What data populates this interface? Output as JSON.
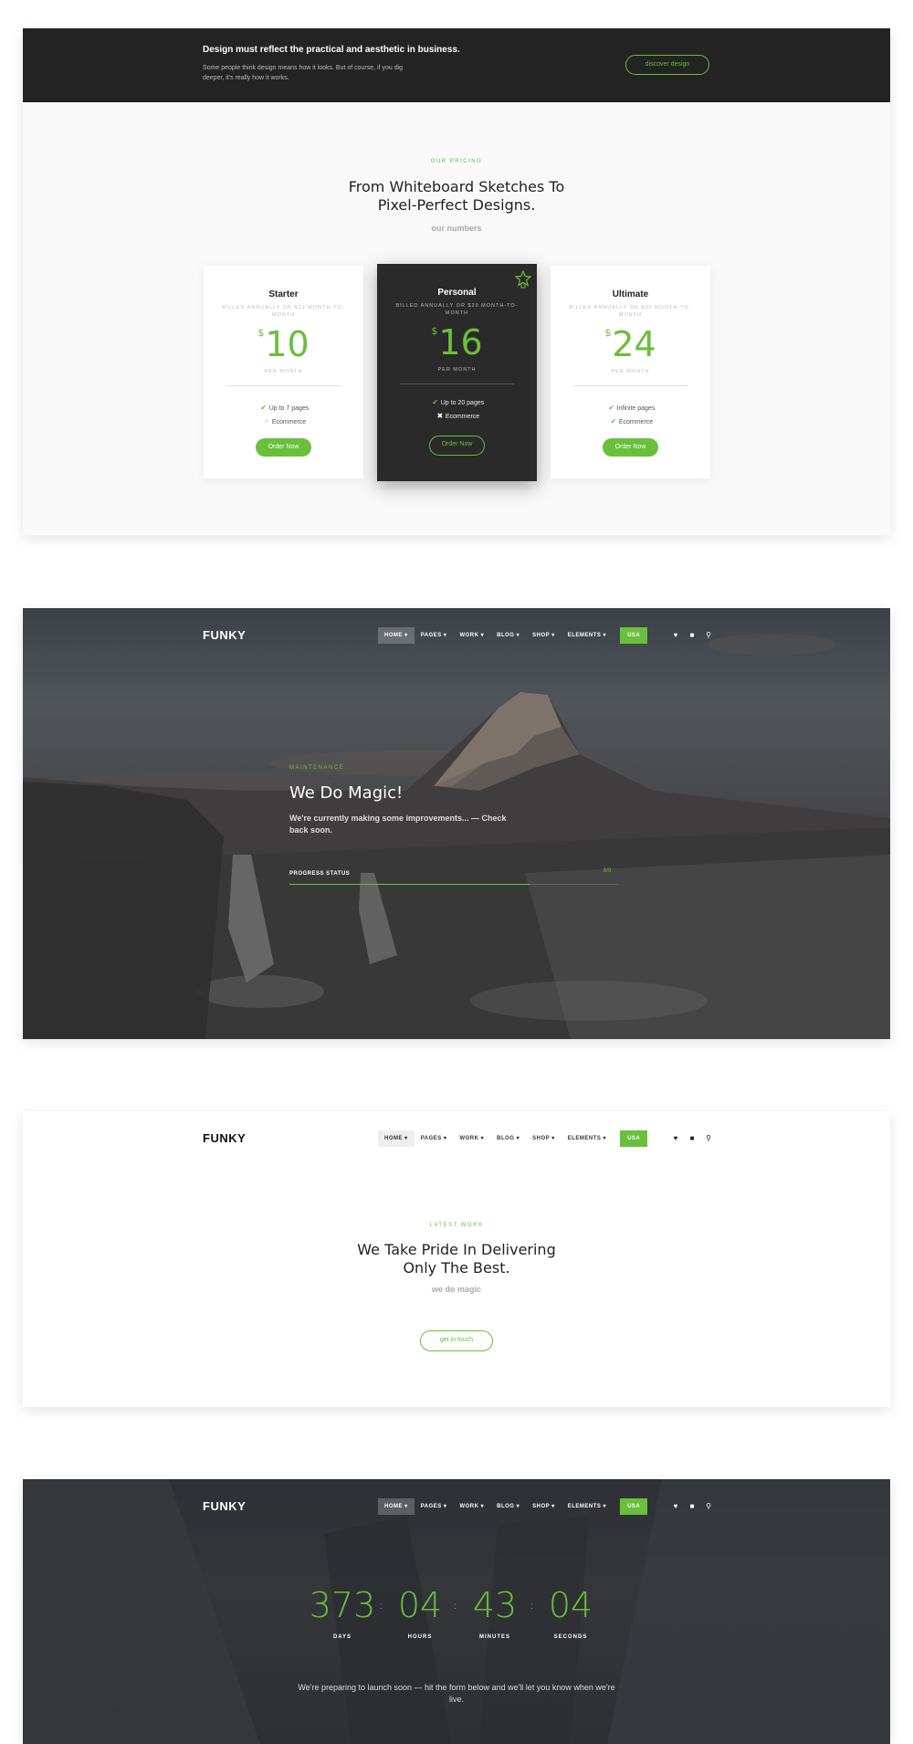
{
  "colors": {
    "accent": "#6abf3b",
    "dark": "#232323"
  },
  "panel1": {
    "bar": {
      "headline": "Design must reflect the practical and aesthetic in business.",
      "text": "Some people think design means how it looks. But of course, if you dig deeper, it's really how it works.",
      "button": "discover design"
    },
    "eyebrow": "OUR PRICING",
    "title_line1": "From Whiteboard Sketches To",
    "title_line2": "Pixel-Perfect Designs.",
    "subtitle": "our numbers",
    "plans": [
      {
        "name": "Starter",
        "billed": "BILLED ANNUALLY OR $12 MONTH-TO-MONTH",
        "currency": "$",
        "price": "10",
        "period": "PER MONTH",
        "features": [
          {
            "label": "Up to 7 pages",
            "mark": "check-icon"
          },
          {
            "label": "Ecommerce",
            "mark": "disabled-icon"
          }
        ],
        "button": "Order Now"
      },
      {
        "name": "Personal",
        "billed": "BILLED ANNUALLY OR $20 MONTH-TO-MONTH",
        "currency": "$",
        "price": "16",
        "period": "PER MONTH",
        "features": [
          {
            "label": "Up to 20 pages",
            "mark": "check-icon"
          },
          {
            "label": "Ecommerce",
            "mark": "close-icon"
          }
        ],
        "button": "Order Now",
        "featured": true
      },
      {
        "name": "Ultimate",
        "billed": "BILLED ANNUALLY OR $30 MONTH-TO-MONTH",
        "currency": "$",
        "price": "24",
        "period": "PER MONTH",
        "features": [
          {
            "label": "Infinite pages",
            "mark": "check-icon"
          },
          {
            "label": "Ecommerce",
            "mark": "check-icon"
          }
        ],
        "button": "Order Now"
      }
    ]
  },
  "nav": {
    "logo": "FUNKY",
    "items": [
      "HOME ▾",
      "PAGES ▾",
      "WORK ▾",
      "BLOG ▾",
      "SHOP ▾",
      "ELEMENTS ▾"
    ],
    "region": "USA"
  },
  "panel2": {
    "eyebrow": "MAINTENANCE",
    "title": "We Do Magic!",
    "text": "We're currently making some improvements... — Check back soon.",
    "progress_label": "PROGRESS STATUS",
    "progress_fraction": 0.73,
    "progress_text": "8/9"
  },
  "panel3": {
    "eyebrow": "LATEST WORK",
    "title_line1": "We Take Pride In Delivering",
    "title_line2": "Only The Best.",
    "subtitle": "we do magic",
    "button": "get in touch"
  },
  "panel4": {
    "countdown": [
      {
        "value": "373",
        "label": "DAYS"
      },
      {
        "value": "04",
        "label": "HOURS"
      },
      {
        "value": "43",
        "label": "MINUTES"
      },
      {
        "value": "04",
        "label": "SECONDS"
      }
    ],
    "text": "We're preparing to launch soon — hit the form below and we'll let you know when we're live."
  }
}
